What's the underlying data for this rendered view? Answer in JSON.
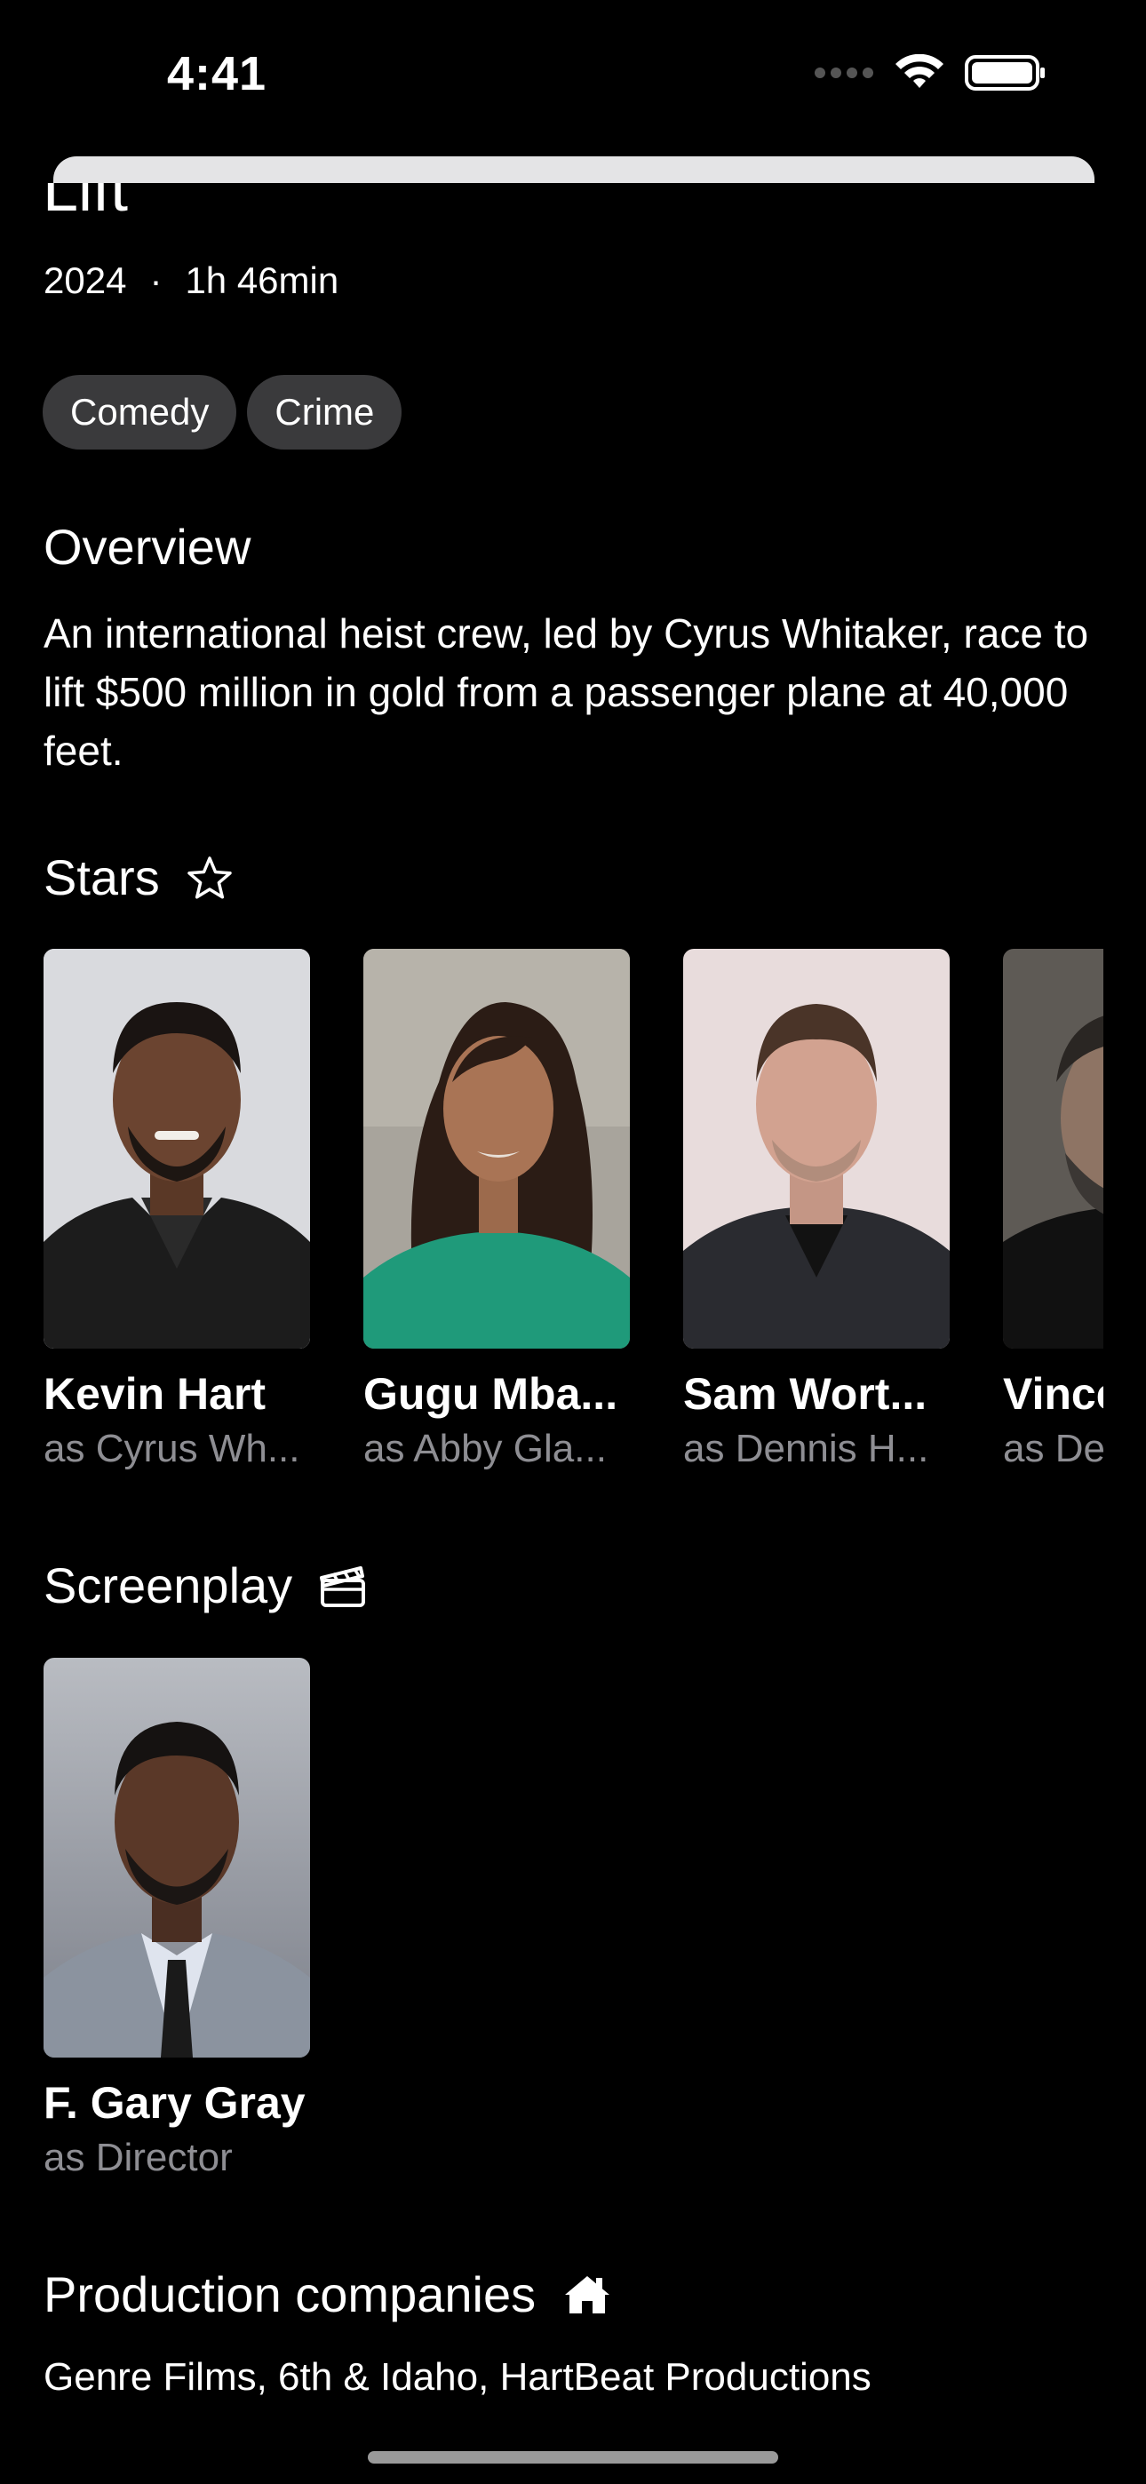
{
  "status_bar": {
    "time": "4:41",
    "icons": [
      "cellular-dots-icon",
      "wifi-icon",
      "battery-icon"
    ]
  },
  "movie": {
    "title": "Lift",
    "year": "2024",
    "separator": "·",
    "runtime": "1h 46min",
    "genres": [
      "Comedy",
      "Crime"
    ]
  },
  "overview": {
    "title": "Overview",
    "text": "An international heist crew, led by Cyrus Whitaker, race to lift $500 million in gold from a passenger plane at 40,000 feet."
  },
  "stars": {
    "title": "Stars",
    "icon": "star-outline-icon",
    "cast": [
      {
        "name": "Kevin Hart",
        "role": "as Cyrus Wh..."
      },
      {
        "name": "Gugu Mba...",
        "role": "as Abby Gla..."
      },
      {
        "name": "Sam Wort...",
        "role": "as Dennis H..."
      },
      {
        "name": "Vince",
        "role": "as De"
      }
    ]
  },
  "screenplay": {
    "title": "Screenplay",
    "icon": "clapperboard-icon",
    "crew": [
      {
        "name": "F. Gary Gray",
        "role": "as Director"
      }
    ]
  },
  "production": {
    "title": "Production companies",
    "icon": "house-icon",
    "companies": "Genre Films, 6th & Idaho, HartBeat Productions"
  },
  "colors": {
    "background": "#000000",
    "chip": "#3a3a3c",
    "secondary_text": "#8e8e93",
    "sheet_edge": "#e4e4e6"
  }
}
